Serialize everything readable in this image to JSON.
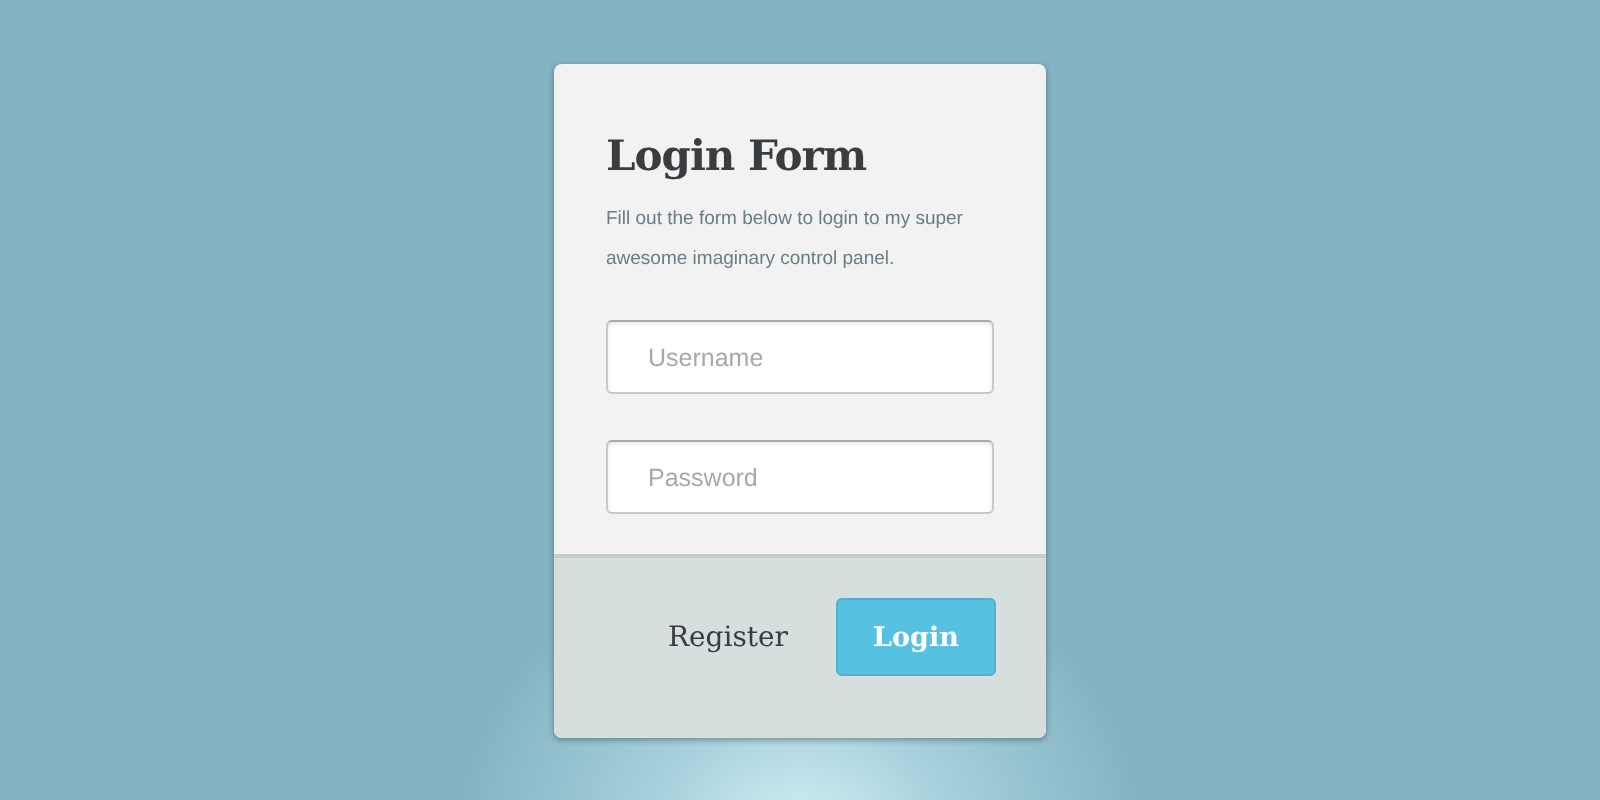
{
  "form": {
    "title": "Login Form",
    "description": "Fill out the form below to login to my super awesome imaginary control panel.",
    "fields": [
      {
        "placeholder": "Username"
      },
      {
        "placeholder": "Password"
      }
    ]
  },
  "footer": {
    "link": "Register",
    "button": "Login"
  }
}
